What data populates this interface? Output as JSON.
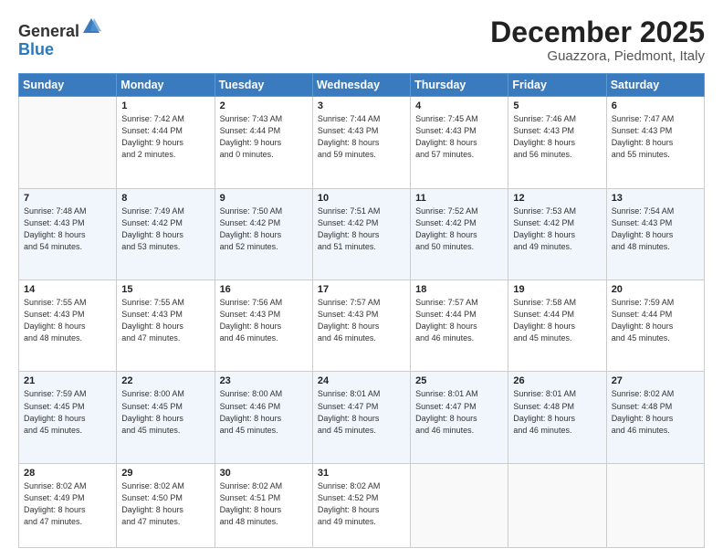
{
  "header": {
    "logo_general": "General",
    "logo_blue": "Blue",
    "title": "December 2025",
    "subtitle": "Guazzora, Piedmont, Italy"
  },
  "weekdays": [
    "Sunday",
    "Monday",
    "Tuesday",
    "Wednesday",
    "Thursday",
    "Friday",
    "Saturday"
  ],
  "weeks": [
    [
      {
        "day": "",
        "info": ""
      },
      {
        "day": "1",
        "info": "Sunrise: 7:42 AM\nSunset: 4:44 PM\nDaylight: 9 hours\nand 2 minutes."
      },
      {
        "day": "2",
        "info": "Sunrise: 7:43 AM\nSunset: 4:44 PM\nDaylight: 9 hours\nand 0 minutes."
      },
      {
        "day": "3",
        "info": "Sunrise: 7:44 AM\nSunset: 4:43 PM\nDaylight: 8 hours\nand 59 minutes."
      },
      {
        "day": "4",
        "info": "Sunrise: 7:45 AM\nSunset: 4:43 PM\nDaylight: 8 hours\nand 57 minutes."
      },
      {
        "day": "5",
        "info": "Sunrise: 7:46 AM\nSunset: 4:43 PM\nDaylight: 8 hours\nand 56 minutes."
      },
      {
        "day": "6",
        "info": "Sunrise: 7:47 AM\nSunset: 4:43 PM\nDaylight: 8 hours\nand 55 minutes."
      }
    ],
    [
      {
        "day": "7",
        "info": "Sunrise: 7:48 AM\nSunset: 4:43 PM\nDaylight: 8 hours\nand 54 minutes."
      },
      {
        "day": "8",
        "info": "Sunrise: 7:49 AM\nSunset: 4:42 PM\nDaylight: 8 hours\nand 53 minutes."
      },
      {
        "day": "9",
        "info": "Sunrise: 7:50 AM\nSunset: 4:42 PM\nDaylight: 8 hours\nand 52 minutes."
      },
      {
        "day": "10",
        "info": "Sunrise: 7:51 AM\nSunset: 4:42 PM\nDaylight: 8 hours\nand 51 minutes."
      },
      {
        "day": "11",
        "info": "Sunrise: 7:52 AM\nSunset: 4:42 PM\nDaylight: 8 hours\nand 50 minutes."
      },
      {
        "day": "12",
        "info": "Sunrise: 7:53 AM\nSunset: 4:42 PM\nDaylight: 8 hours\nand 49 minutes."
      },
      {
        "day": "13",
        "info": "Sunrise: 7:54 AM\nSunset: 4:43 PM\nDaylight: 8 hours\nand 48 minutes."
      }
    ],
    [
      {
        "day": "14",
        "info": "Sunrise: 7:55 AM\nSunset: 4:43 PM\nDaylight: 8 hours\nand 48 minutes."
      },
      {
        "day": "15",
        "info": "Sunrise: 7:55 AM\nSunset: 4:43 PM\nDaylight: 8 hours\nand 47 minutes."
      },
      {
        "day": "16",
        "info": "Sunrise: 7:56 AM\nSunset: 4:43 PM\nDaylight: 8 hours\nand 46 minutes."
      },
      {
        "day": "17",
        "info": "Sunrise: 7:57 AM\nSunset: 4:43 PM\nDaylight: 8 hours\nand 46 minutes."
      },
      {
        "day": "18",
        "info": "Sunrise: 7:57 AM\nSunset: 4:44 PM\nDaylight: 8 hours\nand 46 minutes."
      },
      {
        "day": "19",
        "info": "Sunrise: 7:58 AM\nSunset: 4:44 PM\nDaylight: 8 hours\nand 45 minutes."
      },
      {
        "day": "20",
        "info": "Sunrise: 7:59 AM\nSunset: 4:44 PM\nDaylight: 8 hours\nand 45 minutes."
      }
    ],
    [
      {
        "day": "21",
        "info": "Sunrise: 7:59 AM\nSunset: 4:45 PM\nDaylight: 8 hours\nand 45 minutes."
      },
      {
        "day": "22",
        "info": "Sunrise: 8:00 AM\nSunset: 4:45 PM\nDaylight: 8 hours\nand 45 minutes."
      },
      {
        "day": "23",
        "info": "Sunrise: 8:00 AM\nSunset: 4:46 PM\nDaylight: 8 hours\nand 45 minutes."
      },
      {
        "day": "24",
        "info": "Sunrise: 8:01 AM\nSunset: 4:47 PM\nDaylight: 8 hours\nand 45 minutes."
      },
      {
        "day": "25",
        "info": "Sunrise: 8:01 AM\nSunset: 4:47 PM\nDaylight: 8 hours\nand 46 minutes."
      },
      {
        "day": "26",
        "info": "Sunrise: 8:01 AM\nSunset: 4:48 PM\nDaylight: 8 hours\nand 46 minutes."
      },
      {
        "day": "27",
        "info": "Sunrise: 8:02 AM\nSunset: 4:48 PM\nDaylight: 8 hours\nand 46 minutes."
      }
    ],
    [
      {
        "day": "28",
        "info": "Sunrise: 8:02 AM\nSunset: 4:49 PM\nDaylight: 8 hours\nand 47 minutes."
      },
      {
        "day": "29",
        "info": "Sunrise: 8:02 AM\nSunset: 4:50 PM\nDaylight: 8 hours\nand 47 minutes."
      },
      {
        "day": "30",
        "info": "Sunrise: 8:02 AM\nSunset: 4:51 PM\nDaylight: 8 hours\nand 48 minutes."
      },
      {
        "day": "31",
        "info": "Sunrise: 8:02 AM\nSunset: 4:52 PM\nDaylight: 8 hours\nand 49 minutes."
      },
      {
        "day": "",
        "info": ""
      },
      {
        "day": "",
        "info": ""
      },
      {
        "day": "",
        "info": ""
      }
    ]
  ]
}
